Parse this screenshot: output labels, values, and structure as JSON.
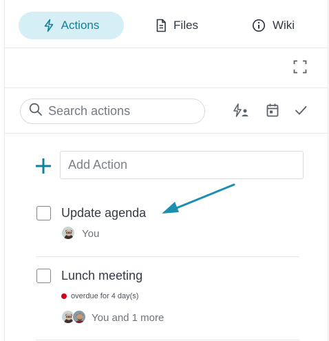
{
  "tabs": [
    {
      "label": "Actions",
      "icon": "lightning-icon",
      "active": true
    },
    {
      "label": "Files",
      "icon": "document-icon",
      "active": false
    },
    {
      "label": "Wiki",
      "icon": "info-icon",
      "active": false
    }
  ],
  "toolbar": {
    "expand_icon": "expand-icon",
    "search_placeholder": "Search actions",
    "assign_filter_icon": "lightning-person-icon",
    "calendar_icon": "calendar-icon",
    "completed_icon": "checkmark-icon"
  },
  "add_action": {
    "placeholder": "Add Action",
    "icon": "plus-icon"
  },
  "actions": [
    {
      "title": "Update agenda",
      "assignee_text": "You",
      "overdue": ""
    },
    {
      "title": "Lunch meeting",
      "assignee_text": "You and 1 more",
      "overdue": "overdue for 4 day(s)"
    }
  ],
  "colors": {
    "accent": "#117f9e",
    "active_tab_bg": "#d6eef5",
    "overdue_dot": "#d0021b",
    "arrow": "#1a8fb0"
  }
}
